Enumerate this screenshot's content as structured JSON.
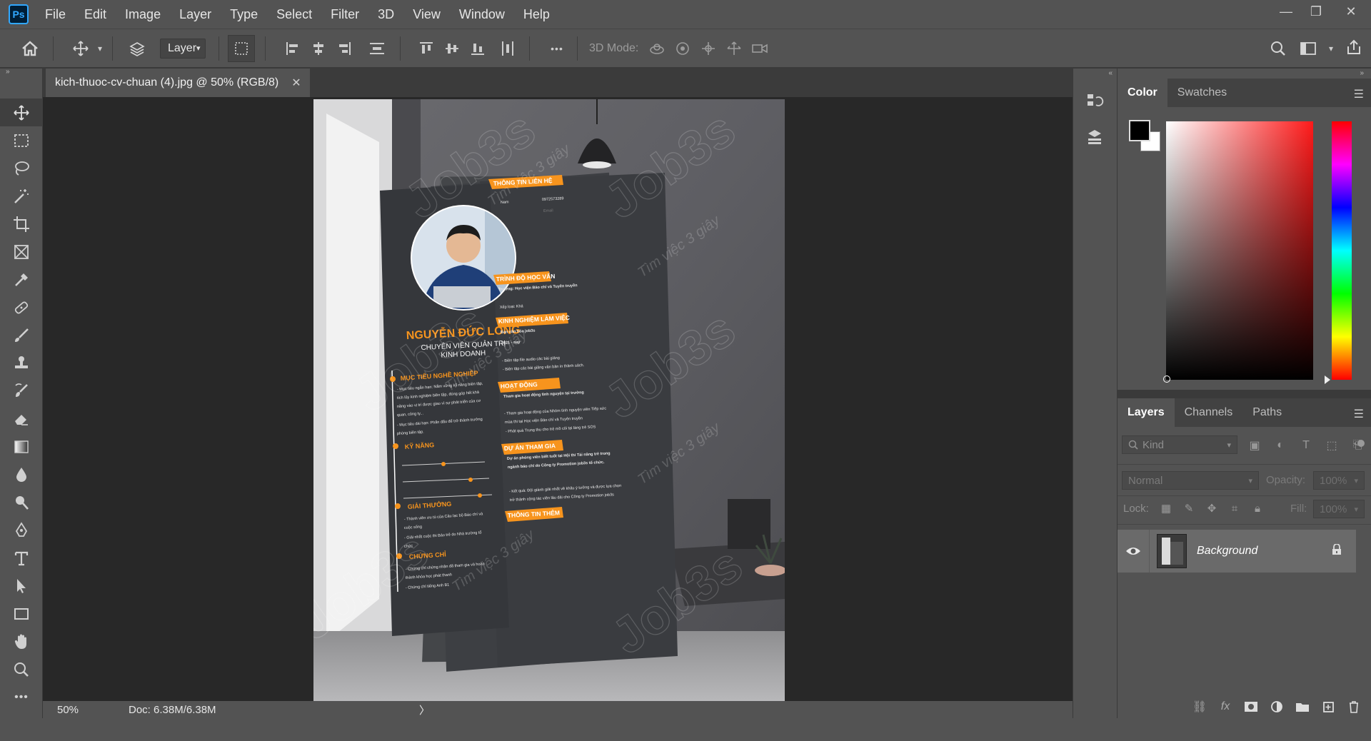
{
  "app": {
    "logo_text": "Ps"
  },
  "menu": [
    "File",
    "Edit",
    "Image",
    "Layer",
    "Type",
    "Select",
    "Filter",
    "3D",
    "View",
    "Window",
    "Help"
  ],
  "window_controls": {
    "minimize": "—",
    "restore": "❐",
    "close": "✕"
  },
  "options_bar": {
    "layer_select": "Layer",
    "mode_label": "3D Mode:",
    "more": "•••"
  },
  "document": {
    "tab_title": "kich-thuoc-cv-chuan (4).jpg @ 50% (RGB/8)",
    "close": "✕",
    "zoom": "50%",
    "doc_info": "Doc: 6.38M/6.38M",
    "status_arrow": "〉"
  },
  "cv": {
    "watermark": "Job3s",
    "watermark_sub": "Tìm việc 3 giây",
    "name": "NGUYỄN ĐỨC LONG",
    "title_line1": "CHUYÊN VIÊN QUẢN TRỊ",
    "title_line2": "KINH DOANH",
    "sections_left": [
      "MỤC TIÊU NGHỀ NGHIỆP",
      "KỸ NĂNG",
      "GIẢI THƯỞNG",
      "CHỨNG CHỈ"
    ],
    "left_texts": {
      "objective": [
        "- Mục tiêu ngắn hạn: Nắm vững kỹ năng biên tập,",
        "tích lũy kinh nghiệm biên tập, đóng góp hết khả",
        "năng vào vị trí được giao vì sự phát triển của cơ",
        "quan, công ty...",
        "- Mục tiêu dài hạn: Phấn đấu để trở thành trưởng",
        "phòng biên tập."
      ],
      "awards": [
        "- Thành viên ưu tú của Câu lạc bộ Báo chí và",
        "cuộc sống",
        "- Giải nhất cuộc thi Báo trẻ do Nhà trường tổ",
        "chức"
      ],
      "certs": [
        "- Chứng chỉ chứng nhận đã tham gia và hoàn",
        "thành khóa học phát thanh",
        "- Chứng chỉ tiếng Anh B1"
      ]
    },
    "sections_right": [
      "THÔNG TIN LIÊN HỆ",
      "TRÌNH ĐỘ HỌC VẤN",
      "KINH NGHIỆM LÀM VIỆC",
      "HOẠT ĐỘNG",
      "DỰ ÁN THAM GIA",
      "THÔNG TIN THÊM"
    ],
    "contact": {
      "gender": "Nam",
      "phone": "0972573289",
      "email_label": "Email"
    },
    "right_texts": {
      "education": [
        "Trường: Học viện Báo chí và Tuyên truyền",
        "Xếp loại: Khá"
      ],
      "experience": [
        "Ban văn hóa job3s",
        "2021 - nay",
        "- Biên tập file audio các bài giảng",
        "- Biên tập các bài giảng văn bản in thành sách."
      ],
      "activities": [
        "Tham gia hoạt động tình nguyện tại trường",
        "- Tham gia hoạt động của Nhóm tình nguyện viên Tiếp sức",
        "mùa thi tại Học viện Báo chí và Tuyên truyền",
        "- Phát quà Trung thu cho trẻ mồ côi tại làng trẻ SOS"
      ],
      "projects": [
        "Dự án phóng viên biết tuốt tại Hội thi Tài năng trẻ trong",
        "ngành báo chí do Công ty Promotion job3s tổ chức.",
        "- Kết quả: Đội giành giải nhất về khâu ý tưởng và được lựa chọn",
        "trở thành cộng tác viên lâu dài cho Công ty Promotion job3s"
      ]
    }
  },
  "panels": {
    "color_tabs": [
      "Color",
      "Swatches"
    ],
    "layers_tabs": [
      "Layers",
      "Channels",
      "Paths"
    ],
    "kind_placeholder": "Kind",
    "blend_mode": "Normal",
    "opacity_label": "Opacity:",
    "opacity_value": "100%",
    "lock_label": "Lock:",
    "fill_label": "Fill:",
    "fill_value": "100%",
    "layers": [
      {
        "name": "Background",
        "visible": true,
        "locked": true
      }
    ],
    "colors": {
      "foreground": "#000000",
      "background": "#ffffff",
      "accent": "#f7941d",
      "cv_dark": "#3a3c40"
    }
  }
}
